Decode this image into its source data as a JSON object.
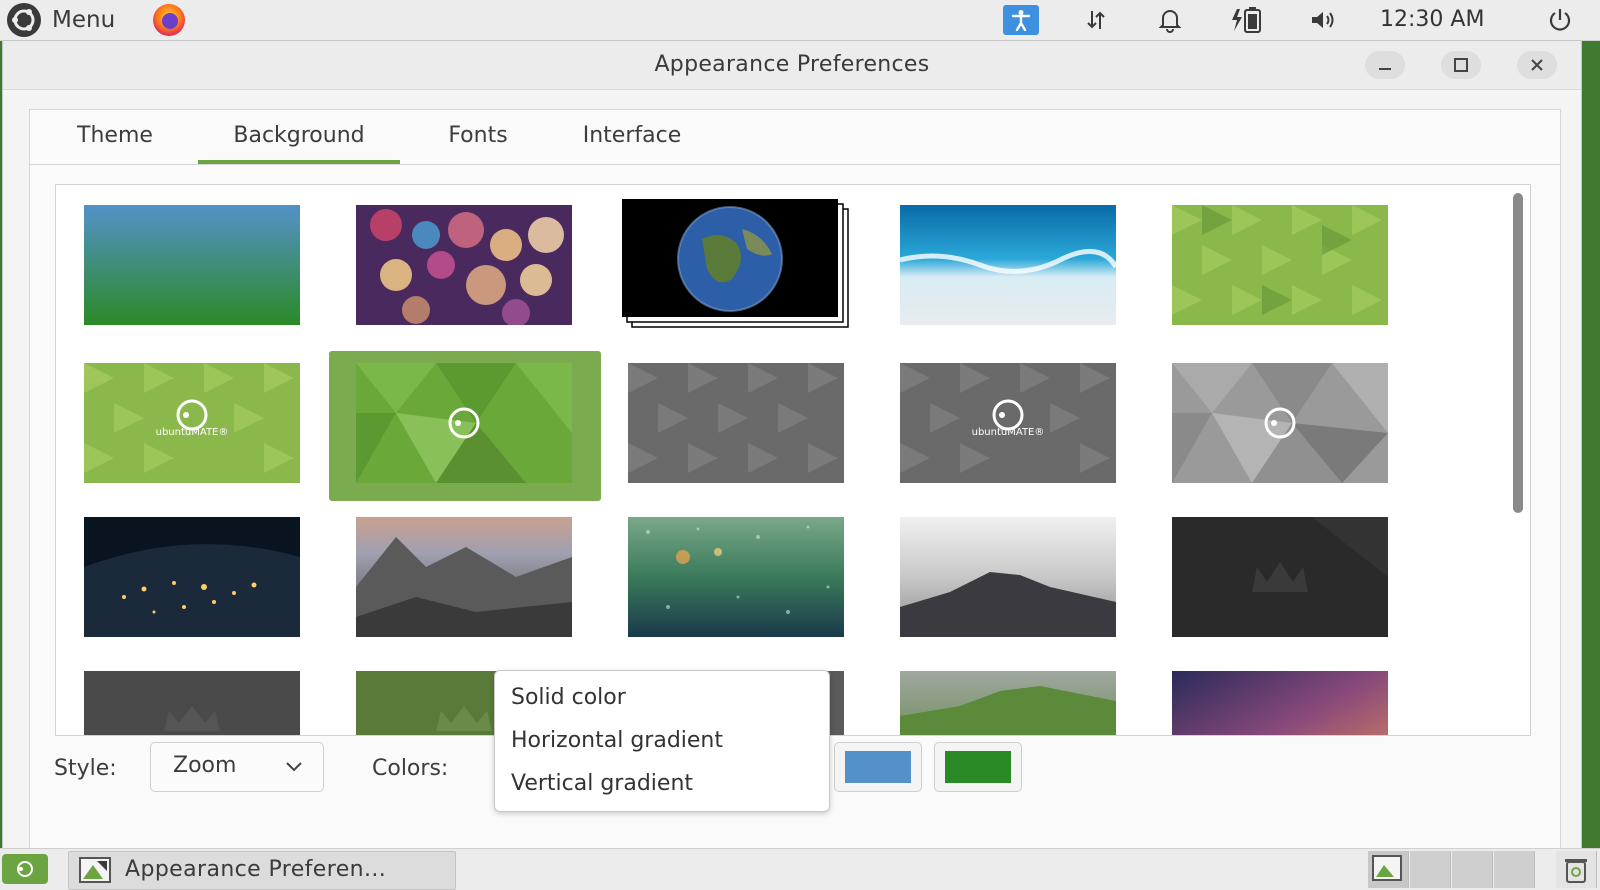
{
  "top_panel": {
    "menu_label": "Menu",
    "clock": "12:30 AM",
    "icons": [
      "mate-logo-icon",
      "firefox-icon",
      "accessibility-icon",
      "network-icon",
      "notification-bell-icon",
      "battery-icon",
      "volume-icon",
      "power-icon"
    ]
  },
  "window": {
    "title": "Appearance Preferences",
    "tabs": [
      {
        "label": "Theme",
        "active": false
      },
      {
        "label": "Background",
        "active": true
      },
      {
        "label": "Fonts",
        "active": false
      },
      {
        "label": "Interface",
        "active": false
      }
    ],
    "style_label": "Style:",
    "style_value": "Zoom",
    "colors_label": "Colors:",
    "color_primary": "#5491c9",
    "color_secondary": "#2a8a26",
    "dropdown_options": [
      "Solid color",
      "Horizontal gradient",
      "Vertical gradient"
    ],
    "thumb_text": "ubuntuMATE®"
  },
  "taskbar": {
    "task_label": "Appearance Preferen..."
  },
  "colors": {
    "accent": "#6ba441",
    "selection": "#7aab4f"
  }
}
